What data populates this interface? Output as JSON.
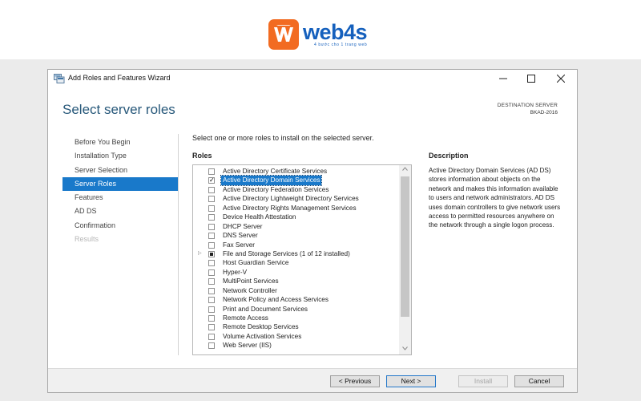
{
  "brand": {
    "name": "web4s",
    "tagline": "4 bước cho 1 trang web",
    "mark": "W",
    "color_accent": "#f26b21",
    "color_text": "#1560bd"
  },
  "window": {
    "title": "Add Roles and Features Wizard",
    "minimize_icon": "minimize-icon",
    "maximize_icon": "maximize-icon",
    "close_icon": "close-icon"
  },
  "page": {
    "heading": "Select server roles",
    "destination_label": "DESTINATION SERVER",
    "destination_value": "BKAD-2016",
    "instruction": "Select one or more roles to install on the selected server.",
    "roles_label": "Roles",
    "description_label": "Description",
    "description_text": "Active Directory Domain Services (AD DS) stores information about objects on the network and makes this information available to users and network administrators. AD DS uses domain controllers to give network users access to permitted resources anywhere on the network through a single logon process."
  },
  "nav": {
    "items": [
      {
        "label": "Before You Begin",
        "state": "normal"
      },
      {
        "label": "Installation Type",
        "state": "normal"
      },
      {
        "label": "Server Selection",
        "state": "normal"
      },
      {
        "label": "Server Roles",
        "state": "active"
      },
      {
        "label": "Features",
        "state": "normal"
      },
      {
        "label": "AD DS",
        "state": "normal"
      },
      {
        "label": "Confirmation",
        "state": "normal"
      },
      {
        "label": "Results",
        "state": "disabled"
      }
    ]
  },
  "roles": [
    {
      "label": "Active Directory Certificate Services",
      "checked": false
    },
    {
      "label": "Active Directory Domain Services",
      "checked": true,
      "selected": true
    },
    {
      "label": "Active Directory Federation Services",
      "checked": false
    },
    {
      "label": "Active Directory Lightweight Directory Services",
      "checked": false
    },
    {
      "label": "Active Directory Rights Management Services",
      "checked": false
    },
    {
      "label": "Device Health Attestation",
      "checked": false
    },
    {
      "label": "DHCP Server",
      "checked": false
    },
    {
      "label": "DNS Server",
      "checked": false
    },
    {
      "label": "Fax Server",
      "checked": false
    },
    {
      "label": "File and Storage Services (1 of 12 installed)",
      "checked": "partial",
      "expandable": true
    },
    {
      "label": "Host Guardian Service",
      "checked": false
    },
    {
      "label": "Hyper-V",
      "checked": false
    },
    {
      "label": "MultiPoint Services",
      "checked": false
    },
    {
      "label": "Network Controller",
      "checked": false
    },
    {
      "label": "Network Policy and Access Services",
      "checked": false
    },
    {
      "label": "Print and Document Services",
      "checked": false
    },
    {
      "label": "Remote Access",
      "checked": false
    },
    {
      "label": "Remote Desktop Services",
      "checked": false
    },
    {
      "label": "Volume Activation Services",
      "checked": false
    },
    {
      "label": "Web Server (IIS)",
      "checked": false
    }
  ],
  "buttons": {
    "previous": "< Previous",
    "next": "Next >",
    "install": "Install",
    "cancel": "Cancel"
  },
  "colors": {
    "selection": "#1979ca",
    "heading": "#27587a"
  }
}
